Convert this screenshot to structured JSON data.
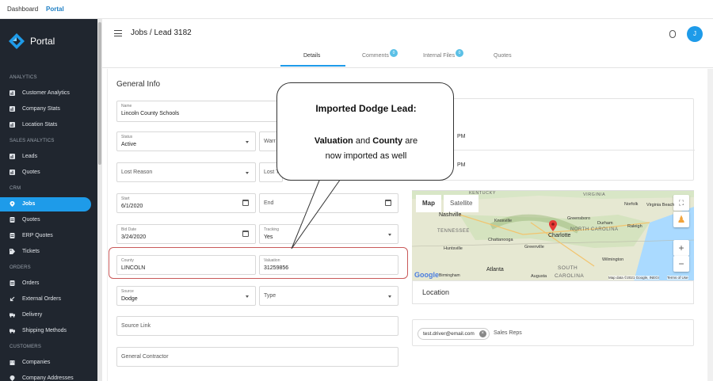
{
  "topnav": {
    "dashboard": "Dashboard",
    "portal": "Portal"
  },
  "sidebar": {
    "logo_text": "Portal",
    "sections": {
      "analytics": "ANALYTICS",
      "sales_analytics": "SALES ANALYTICS",
      "crm": "CRM",
      "orders": "ORDERS",
      "customers": "CUSTOMERS"
    },
    "items": {
      "customer_analytics": "Customer Analytics",
      "company_stats": "Company Stats",
      "location_stats": "Location Stats",
      "leads": "Leads",
      "quotes_sales": "Quotes",
      "jobs": "Jobs",
      "quotes_crm": "Quotes",
      "erp_quotes": "ERP Quotes",
      "tickets": "Tickets",
      "orders": "Orders",
      "external_orders": "External Orders",
      "delivery": "Delivery",
      "shipping_methods": "Shipping Methods",
      "companies": "Companies",
      "company_addresses": "Company Addresses"
    }
  },
  "header": {
    "title": "Jobs / Lead 3182",
    "avatar": "J",
    "tabs": {
      "details": "Details",
      "comments": "Comments",
      "internal_files": "Internal Files",
      "quotes": "Quotes"
    },
    "comments_badge": "0",
    "files_badge": "0"
  },
  "form": {
    "section_title": "General Info",
    "name": {
      "label": "Name",
      "value": "Lincoln County Schools"
    },
    "status": {
      "label": "Status",
      "value": "Active"
    },
    "warranty": {
      "value": "Warr"
    },
    "lost_reason": {
      "placeholder": "Lost Reason"
    },
    "lost_t": {
      "placeholder": "Lost T"
    },
    "start": {
      "label": "Start",
      "value": "6/1/2020"
    },
    "end": {
      "placeholder": "End"
    },
    "bid_date": {
      "label": "Bid Date",
      "value": "3/24/2020"
    },
    "tracking": {
      "label": "Tracking",
      "value": "Yes"
    },
    "county": {
      "label": "County",
      "value": "LINCOLN"
    },
    "valuation": {
      "label": "Valuation",
      "value": "31259856"
    },
    "source": {
      "label": "Source",
      "value": "Dodge"
    },
    "type": {
      "placeholder": "Type"
    },
    "source_link": {
      "placeholder": "Source Link"
    },
    "general_contractor": {
      "placeholder": "General Contractor"
    },
    "time1": "PM",
    "time2": "PM"
  },
  "callout": {
    "title": "Imported Dodge Lead:",
    "w1": "Valuation",
    "w2": " and ",
    "w3": "County",
    "w4": " are",
    "line2": "now imported as well"
  },
  "map": {
    "tab_map": "Map",
    "tab_satellite": "Satellite",
    "labels": {
      "kentucky": "KENTUCKY",
      "virginia": "VIRGINIA",
      "norfolk": "Norfolk",
      "virginia_beach": "Virginia Beach",
      "nashville": "Nashville",
      "knoxville": "Knoxville",
      "tennessee": "TENNESSEE",
      "chattanooga": "Chattanooga",
      "charlotte": "Charlotte",
      "greensboro": "Greensboro",
      "durham": "Durham",
      "north_carolina": "NORTH CAROLINA",
      "raleigh": "Raleigh",
      "huntsville": "Huntsville",
      "greenville": "Greenville",
      "wilmington": "Wilmington",
      "atlanta": "Atlanta",
      "south": "SOUTH",
      "augusta": "Augusta",
      "birmingham": "Birmingham",
      "carolina": "CAROLINA",
      "google": "Google",
      "attribution": "Map data ©2021 Google, INEGI",
      "terms": "Terms of Use"
    }
  },
  "location": {
    "label": "Location"
  },
  "reps": {
    "chip": "test.driver@email.com",
    "label": "Sales Reps"
  },
  "colors": {
    "accent": "#1e9be9",
    "sidebar_bg": "#20262f",
    "highlight": "#c95a5a"
  }
}
